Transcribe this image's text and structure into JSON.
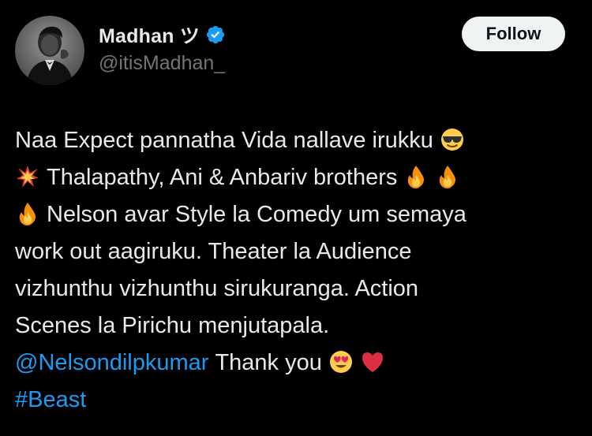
{
  "author": {
    "display_name": "Madhan ツ",
    "handle": "@itisMadhan_",
    "verified": true
  },
  "follow_button": {
    "label": "Follow"
  },
  "tweet": {
    "lines": [
      "Naa Expect pannatha Vida nallave irukku",
      "Thalapathy, Ani & Anbariv brothers",
      "Nelson avar Style la Comedy um semaya",
      "work out aagiruku. Theater la Audience",
      "vizhunthu vizhunthu sirukuranga. Action",
      "Scenes la Pirichu menjutapala.",
      "Thank you"
    ],
    "mention": "@Nelsondilpkumar",
    "hashtag": "#Beast",
    "emojis": [
      "sunglasses-emoji",
      "collision-emoji",
      "fire-emoji",
      "heart-eyes-emoji",
      "red-heart-emoji"
    ]
  },
  "colors": {
    "background": "#000000",
    "text": "#e7e9ea",
    "secondary_text": "#71767b",
    "link": "#1d9bf0",
    "verified_badge": "#1d9bf0",
    "follow_button_bg": "#eff3f4"
  }
}
